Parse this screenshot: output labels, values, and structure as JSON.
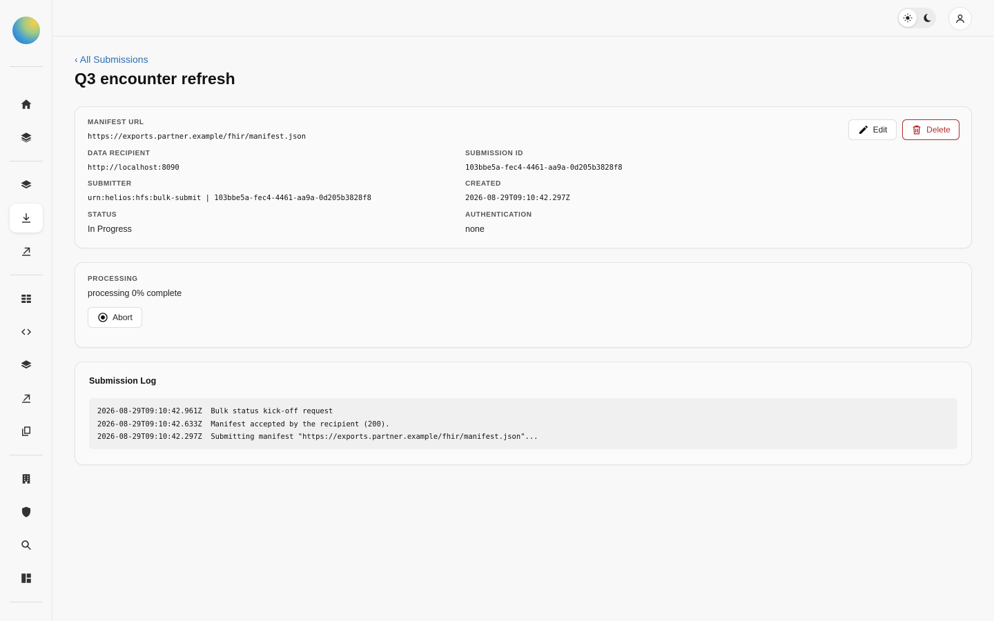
{
  "sidebar": {
    "items": [
      {
        "icon": "home-icon",
        "name": "nav-home"
      },
      {
        "icon": "layers-icon",
        "name": "nav-layers"
      },
      {
        "icon": "layers-icon",
        "name": "nav-layers-2"
      },
      {
        "icon": "download-icon",
        "name": "nav-submissions",
        "active": true
      },
      {
        "icon": "upload-icon",
        "name": "nav-upload"
      },
      {
        "icon": "table-icon",
        "name": "nav-tables"
      },
      {
        "icon": "code-icon",
        "name": "nav-code"
      },
      {
        "icon": "layers-icon",
        "name": "nav-layers-3"
      },
      {
        "icon": "upload-icon",
        "name": "nav-upload-2"
      },
      {
        "icon": "copy-icon",
        "name": "nav-copy"
      },
      {
        "icon": "building-icon",
        "name": "nav-organization"
      },
      {
        "icon": "shield-icon",
        "name": "nav-security"
      },
      {
        "icon": "search-icon",
        "name": "nav-search"
      },
      {
        "icon": "dashboard-icon",
        "name": "nav-dashboard"
      }
    ]
  },
  "header": {
    "theme_options": [
      "sun-icon",
      "moon-icon"
    ],
    "user_icon": "user-icon"
  },
  "page": {
    "back_link": "‹ All Submissions",
    "title": "Q3 encounter refresh"
  },
  "details": {
    "manifest_url_label": "MANIFEST URL",
    "manifest_url": "https://exports.partner.example/fhir/manifest.json",
    "data_recipient_label": "DATA RECIPIENT",
    "data_recipient": "http://localhost:8090",
    "submission_id_label": "SUBMISSION ID",
    "submission_id": "103bbe5a-fec4-4461-aa9a-0d205b3828f8",
    "submitter_label": "SUBMITTER",
    "submitter": "urn:helios:hfs:bulk-submit | 103bbe5a-fec4-4461-aa9a-0d205b3828f8",
    "created_label": "CREATED",
    "created": "2026-08-29T09:10:42.297Z",
    "status_label": "STATUS",
    "status": "In Progress",
    "authentication_label": "AUTHENTICATION",
    "authentication": "none",
    "edit_label": "Edit",
    "delete_label": "Delete"
  },
  "processing": {
    "label": "PROCESSING",
    "text": "processing 0% complete",
    "progress_percent": 0,
    "abort_label": "Abort"
  },
  "log": {
    "title": "Submission Log",
    "lines": [
      "2026-08-29T09:10:42.961Z  Bulk status kick-off request",
      "2026-08-29T09:10:42.633Z  Manifest accepted by the recipient (200).",
      "2026-08-29T09:10:42.297Z  Submitting manifest \"https://exports.partner.example/fhir/manifest.json\"..."
    ]
  },
  "colors": {
    "link": "#2b6fb6",
    "danger": "#b22b2b",
    "background": "#f8f8f8"
  }
}
